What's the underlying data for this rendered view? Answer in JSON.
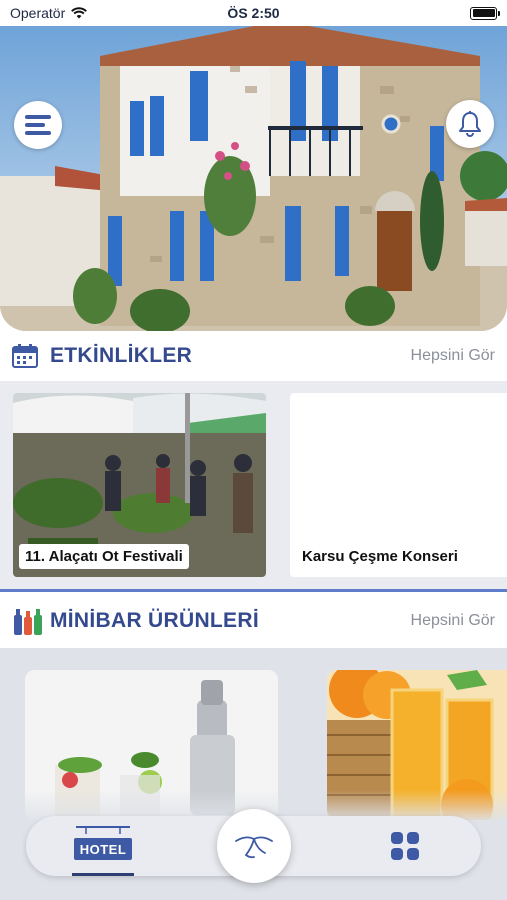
{
  "status_bar": {
    "carrier": "Operatör",
    "time": "ÖS 2:50"
  },
  "hero": {
    "menu_icon": "hamburger-menu-icon",
    "bell_icon": "bell-icon"
  },
  "events": {
    "title": "ETKİNLİKLER",
    "see_all": "Hepsini Gör",
    "items": [
      {
        "label": "11. Alaçatı Ot Festivali"
      },
      {
        "label": "Karsu Çeşme Konseri"
      }
    ]
  },
  "minibar": {
    "title": "MİNİBAR ÜRÜNLERİ",
    "see_all": "Hepsini Gör"
  },
  "tab_bar": {
    "home_label": "HOTEL",
    "center_icon": "brand-logo-icon",
    "grid_icon": "grid-icon"
  },
  "colors": {
    "accent": "#34498e",
    "tab_blue": "#3f5aa5",
    "divider": "#5f7cc8"
  }
}
